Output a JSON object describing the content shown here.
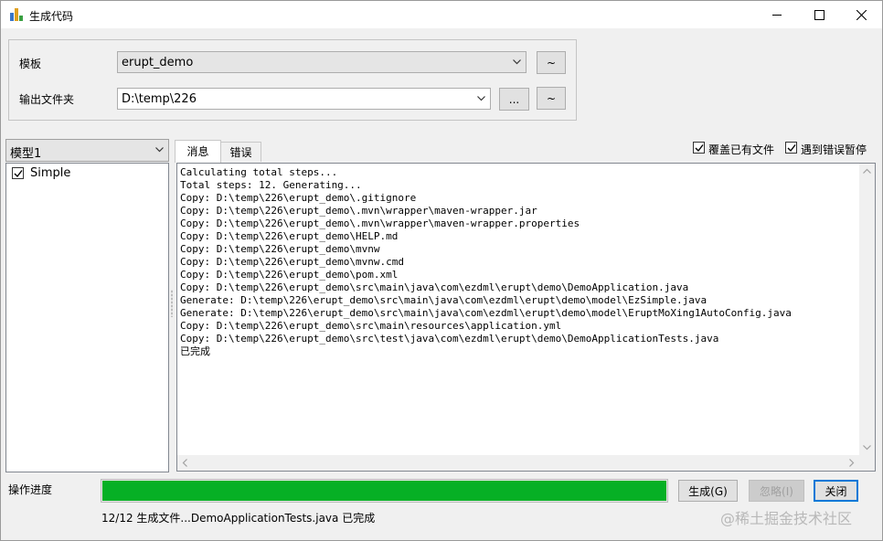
{
  "window": {
    "title": "生成代码",
    "controls": [
      "minimize-icon",
      "maximize-icon",
      "close-icon"
    ]
  },
  "settings": {
    "template_label": "模板",
    "template_value": "erupt_demo",
    "template_extra_button": "~",
    "output_label": "输出文件夹",
    "output_value": "D:\\temp\\226",
    "browse_button": "...",
    "output_extra_button": "~"
  },
  "models": {
    "selected": "模型1",
    "items": [
      {
        "label": "Simple",
        "checked": true
      }
    ]
  },
  "tabs": [
    {
      "label": "消息",
      "active": true
    },
    {
      "label": "错误",
      "active": false
    }
  ],
  "options": {
    "overwrite_label": "覆盖已有文件",
    "overwrite_checked": true,
    "pause_on_error_label": "遇到错误暂停",
    "pause_on_error_checked": true
  },
  "log": [
    "Calculating total steps...",
    "Total steps: 12. Generating...",
    "Copy: D:\\temp\\226\\erupt_demo\\.gitignore",
    "Copy: D:\\temp\\226\\erupt_demo\\.mvn\\wrapper\\maven-wrapper.jar",
    "Copy: D:\\temp\\226\\erupt_demo\\.mvn\\wrapper\\maven-wrapper.properties",
    "Copy: D:\\temp\\226\\erupt_demo\\HELP.md",
    "Copy: D:\\temp\\226\\erupt_demo\\mvnw",
    "Copy: D:\\temp\\226\\erupt_demo\\mvnw.cmd",
    "Copy: D:\\temp\\226\\erupt_demo\\pom.xml",
    "Copy: D:\\temp\\226\\erupt_demo\\src\\main\\java\\com\\ezdml\\erupt\\demo\\DemoApplication.java",
    "Generate: D:\\temp\\226\\erupt_demo\\src\\main\\java\\com\\ezdml\\erupt\\demo\\model\\EzSimple.java",
    "Generate: D:\\temp\\226\\erupt_demo\\src\\main\\java\\com\\ezdml\\erupt\\demo\\model\\EruptMoXing1AutoConfig.java",
    "Copy: D:\\temp\\226\\erupt_demo\\src\\main\\resources\\application.yml",
    "Copy: D:\\temp\\226\\erupt_demo\\src\\test\\java\\com\\ezdml\\erupt\\demo\\DemoApplicationTests.java",
    "已完成"
  ],
  "progress": {
    "label": "操作进度",
    "value": 1.0,
    "color": "#06b025",
    "status_text": "12/12 生成文件...DemoApplicationTests.java 已完成"
  },
  "actions": {
    "generate_label": "生成(G)",
    "ignore_label": "忽略(I)",
    "close_label": "关闭"
  },
  "watermark": "@稀土掘金技术社区"
}
